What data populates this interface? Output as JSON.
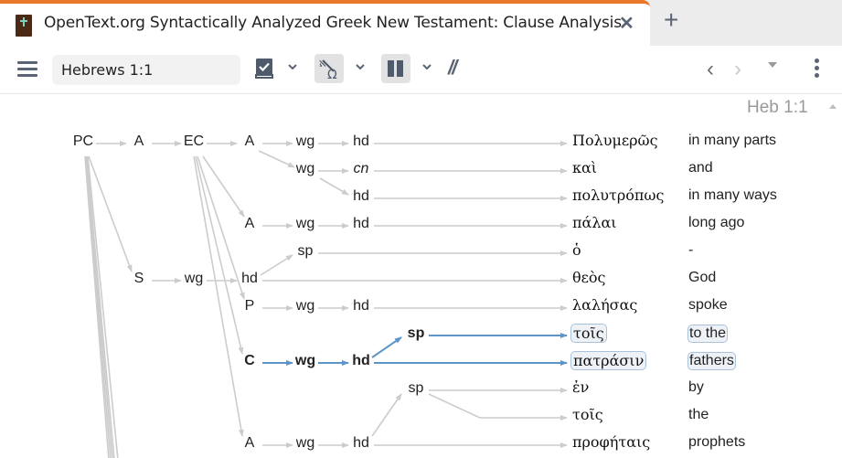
{
  "tab": {
    "title": "OpenText.org Syntactically Analyzed Greek New Testament: Clause Analysis",
    "icon": "bible-book-icon",
    "close_icon": "close-icon",
    "new_tab_icon": "plus-icon"
  },
  "toolbar": {
    "menu_icon": "hamburger-menu-icon",
    "reference_value": "Hebrews 1:1",
    "buttons": [
      {
        "name": "reading-plan",
        "icon": "book-check-icon",
        "active": false
      },
      {
        "name": "interlinear",
        "icon": "omega-link-icon",
        "active": true
      },
      {
        "name": "parallel",
        "icon": "columns-icon",
        "active": true
      },
      {
        "name": "clause-markers",
        "icon": "double-slash-icon",
        "active": false
      }
    ],
    "slashes_label": "//",
    "prev_icon": "chevron-left-icon",
    "next_icon": "chevron-right-icon",
    "history_icon": "caret-down-icon",
    "more_icon": "kebab-icon"
  },
  "content": {
    "verse_reference": "Heb 1:1",
    "colors": {
      "edge": "#cccccc",
      "highlight_edge": "#5b95c9",
      "highlight_bg": "#eef2f7",
      "highlight_border": "#a9c2dc"
    },
    "nodes": [
      {
        "id": "pc",
        "label": "PC"
      },
      {
        "id": "a1",
        "label": "A"
      },
      {
        "id": "ec",
        "label": "EC"
      },
      {
        "id": "a2",
        "label": "A"
      },
      {
        "id": "wg1",
        "label": "wg"
      },
      {
        "id": "hd1",
        "label": "hd"
      },
      {
        "id": "wg2",
        "label": "wg"
      },
      {
        "id": "cn",
        "label": "cn"
      },
      {
        "id": "hd2",
        "label": "hd"
      },
      {
        "id": "a3",
        "label": "A"
      },
      {
        "id": "wg3",
        "label": "wg"
      },
      {
        "id": "hd3",
        "label": "hd"
      },
      {
        "id": "sp1",
        "label": "sp"
      },
      {
        "id": "s",
        "label": "S"
      },
      {
        "id": "wg4",
        "label": "wg"
      },
      {
        "id": "hd4",
        "label": "hd"
      },
      {
        "id": "p",
        "label": "P"
      },
      {
        "id": "wg5",
        "label": "wg"
      },
      {
        "id": "hd5",
        "label": "hd"
      },
      {
        "id": "sp2",
        "label": "sp"
      },
      {
        "id": "c",
        "label": "C"
      },
      {
        "id": "wg6",
        "label": "wg"
      },
      {
        "id": "hd6",
        "label": "hd"
      },
      {
        "id": "sp3",
        "label": "sp"
      },
      {
        "id": "a4",
        "label": "A"
      },
      {
        "id": "wg7",
        "label": "wg"
      },
      {
        "id": "hd7",
        "label": "hd"
      }
    ],
    "words": [
      {
        "greek": "Πολυμερῶς",
        "gloss": "in many parts",
        "highlight": false
      },
      {
        "greek": "καὶ",
        "gloss": "and",
        "highlight": false
      },
      {
        "greek": "πολυτρόπως",
        "gloss": "in many ways",
        "highlight": false
      },
      {
        "greek": "πάλαι",
        "gloss": "long ago",
        "highlight": false
      },
      {
        "greek": "ὁ",
        "gloss": "-",
        "highlight": false
      },
      {
        "greek": "θεὸς",
        "gloss": "God",
        "highlight": false
      },
      {
        "greek": "λαλήσας",
        "gloss": "spoke",
        "highlight": false
      },
      {
        "greek": "τοῖς",
        "gloss": "to the",
        "highlight": true
      },
      {
        "greek": "πατράσιν",
        "gloss": "fathers",
        "highlight": true
      },
      {
        "greek": "ἐν",
        "gloss": "by",
        "highlight": false
      },
      {
        "greek": "τοῖς",
        "gloss": "the",
        "highlight": false
      },
      {
        "greek": "προφήταις",
        "gloss": "prophets",
        "highlight": false
      }
    ]
  }
}
